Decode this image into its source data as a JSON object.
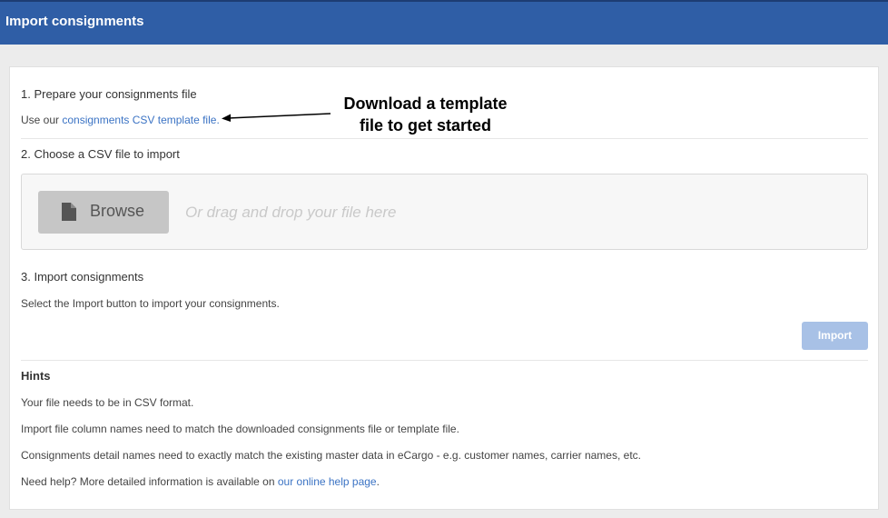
{
  "header": {
    "title": "Import consignments"
  },
  "step1": {
    "title": "1. Prepare your consignments file",
    "prefix": "Use our ",
    "link": "consignments CSV template file."
  },
  "annotation": {
    "line1": "Download a template",
    "line2": "file to get started"
  },
  "step2": {
    "title": "2. Choose a CSV file to import",
    "browse_label": "Browse",
    "drop_hint": "Or drag and drop your file here",
    "browse_icon": "file-icon"
  },
  "step3": {
    "title": "3. Import consignments",
    "description": "Select the Import button to import your consignments.",
    "import_label": "Import"
  },
  "hints": {
    "title": "Hints",
    "items": [
      "Your file needs to be in CSV format.",
      "Import file column names need to match the downloaded consignments file or template file.",
      "Consignments detail names need to exactly match the existing master data in eCargo - e.g. customer names, carrier names, etc."
    ],
    "help_prefix": "Need help? More detailed information is available on ",
    "help_link": "our online help page",
    "help_suffix": "."
  },
  "colors": {
    "header_bg": "#2f5ea6",
    "link": "#3b73c4",
    "import_button": "#a8c1e6",
    "browse_button": "#c6c6c6"
  }
}
